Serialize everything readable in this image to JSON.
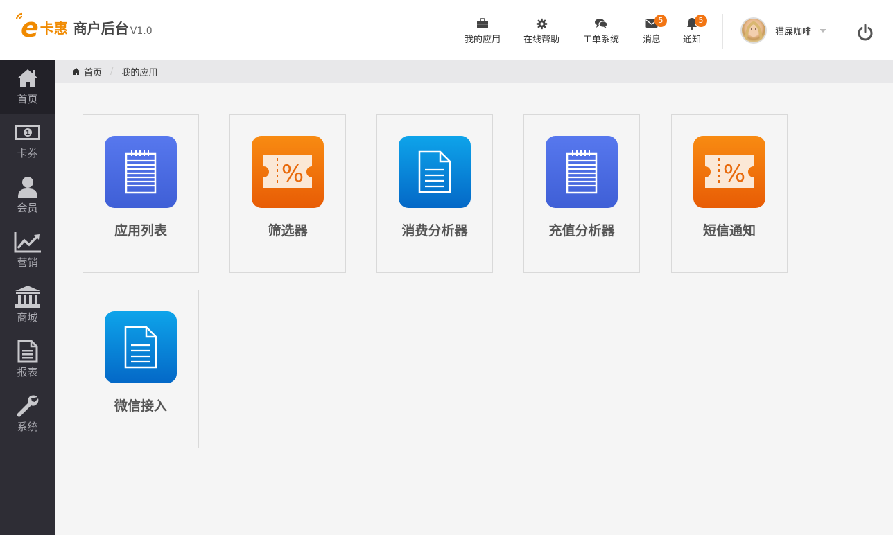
{
  "header": {
    "logo": {
      "mark": "e",
      "brand": "卡惠",
      "product": "商户后台",
      "version": "V1.0"
    },
    "nav": [
      {
        "id": "apps",
        "label": "我的应用",
        "icon": "briefcase-icon"
      },
      {
        "id": "help",
        "label": "在线帮助",
        "icon": "gear-icon"
      },
      {
        "id": "ticket",
        "label": "工单系统",
        "icon": "chat-icon"
      },
      {
        "id": "messages",
        "label": "消息",
        "icon": "envelope-icon",
        "badge": "5"
      },
      {
        "id": "notices",
        "label": "通知",
        "icon": "bell-icon",
        "badge": "5"
      }
    ],
    "user": {
      "name": "猫屎咖啡"
    }
  },
  "sidebar": {
    "items": [
      {
        "label": "首页",
        "icon": "home-icon",
        "active": true
      },
      {
        "label": "卡券",
        "icon": "banknote-icon"
      },
      {
        "label": "会员",
        "icon": "user-icon"
      },
      {
        "label": "营销",
        "icon": "line-chart-icon"
      },
      {
        "label": "商城",
        "icon": "bank-icon"
      },
      {
        "label": "报表",
        "icon": "document-icon"
      },
      {
        "label": "系统",
        "icon": "wrench-icon"
      }
    ]
  },
  "breadcrumb": {
    "home": "首页",
    "current": "我的应用"
  },
  "apps": [
    {
      "name": "应用列表",
      "icon": "notepad-icon",
      "color": "#4a6be3"
    },
    {
      "name": "筛选器",
      "icon": "coupon-icon",
      "color": "#f0740b"
    },
    {
      "name": "消费分析器",
      "icon": "file-icon",
      "color": "#0990dc"
    },
    {
      "name": "充值分析器",
      "icon": "notepad-icon",
      "color": "#4a6be3"
    },
    {
      "name": "短信通知",
      "icon": "coupon-icon",
      "color": "#f0740b"
    },
    {
      "name": "微信接入",
      "icon": "file-icon",
      "color": "#0990dc"
    }
  ]
}
